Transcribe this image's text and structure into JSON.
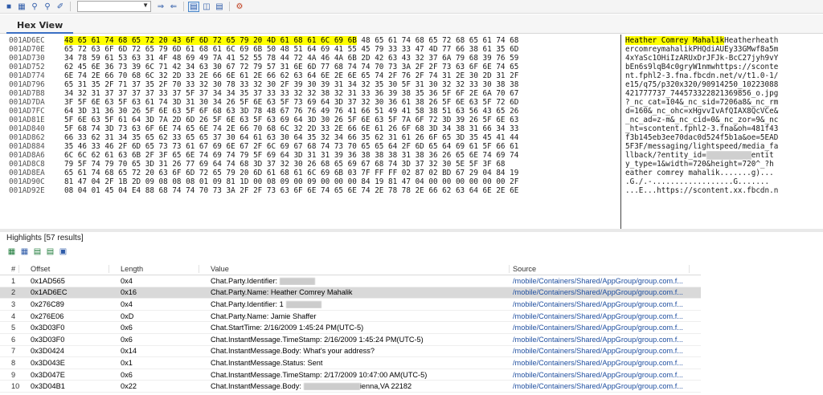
{
  "toolbar": {
    "icons": [
      "save-icon",
      "save-as-icon",
      "find-icon",
      "find-next-icon",
      "paperclip-icon",
      "bookmark-icon",
      "goto-icon",
      "goto-back-icon",
      "view-hex-icon",
      "view-split-icon",
      "view-text-icon",
      "tools-icon"
    ],
    "select_value": ""
  },
  "tab": {
    "label": "Hex View"
  },
  "hex": {
    "offsets": [
      "001AD6EC",
      "001AD70E",
      "001AD730",
      "001AD752",
      "001AD774",
      "001AD796",
      "001AD7B8",
      "001AD7DA",
      "001AD7FC",
      "001AD81E",
      "001AD840",
      "001AD862",
      "001AD884",
      "001AD8A6",
      "001AD8C8",
      "001AD8EA",
      "001AD90C",
      "001AD92E"
    ],
    "highlight_bytes": "48 65 61 74 68 65 72 20 43 6F 6D 72 65 79 20 4D 61 68 61 6C 69 6B",
    "first_row_rest": " 48 65 61 74 68 65 72 68 65 61 74 68",
    "rows": [
      "65 72 63 6F 6D 72 65 79 6D 61 68 61 6C 69 6B 50 48 51 64 69 41 55 45 79 33 33 47 4D 77 66 38 61 35 6D",
      "34 78 59 61 53 63 31 4F 48 69 49 7A 41 52 55 78 44 72 4A 46 4A 6B 2D 42 63 43 32 37 6A 79 68 39 76 59",
      "62 45 6E 36 73 39 6C 71 42 34 63 30 67 72 79 57 31 6E 6D 77 68 74 74 70 73 3A 2F 2F 73 63 6F 6E 74 65",
      "6E 74 2E 66 70 68 6C 32 2D 33 2E 66 6E 61 2E 66 62 63 64 6E 2E 6E 65 74 2F 76 2F 74 31 2E 30 2D 31 2F",
      "65 31 35 2F 71 37 35 2F 70 33 32 30 78 33 32 30 2F 39 30 39 31 34 32 35 30 5F 31 30 32 32 33 30 38 38",
      "34 32 31 37 37 37 37 33 37 5F 37 34 34 35 37 33 33 32 32 38 32 31 33 36 39 38 35 36 5F 6F 2E 6A 70 67",
      "3F 5F 6E 63 5F 63 61 74 3D 31 30 34 26 5F 6E 63 5F 73 69 64 3D 37 32 30 36 61 38 26 5F 6E 63 5F 72 6D",
      "64 3D 31 36 30 26 5F 6E 63 5F 6F 68 63 3D 78 48 67 76 76 49 76 41 66 51 49 41 58 38 51 63 56 43 65 26",
      "5F 6E 63 5F 61 64 3D 7A 2D 6D 26 5F 6E 63 5F 63 69 64 3D 30 26 5F 6E 63 5F 7A 6F 72 3D 39 26 5F 6E 63",
      "5F 68 74 3D 73 63 6F 6E 74 65 6E 74 2E 66 70 68 6C 32 2D 33 2E 66 6E 61 26 6F 68 3D 34 38 31 66 34 33",
      "66 33 62 31 34 35 65 62 33 65 65 37 30 64 61 63 30 64 35 32 34 66 35 62 31 61 26 6F 65 3D 35 45 41 44",
      "35 46 33 46 2F 6D 65 73 73 61 67 69 6E 67 2F 6C 69 67 68 74 73 70 65 65 64 2F 6D 65 64 69 61 5F 66 61",
      "6C 6C 62 61 63 6B 2F 3F 65 6E 74 69 74 79 5F 69 64 3D 31 31 39 36 38 38 38 31 38 36 26 65 6E 74 69 74",
      "79 5F 74 79 70 65 3D 31 26 77 69 64 74 68 3D 37 32 30 26 68 65 69 67 68 74 3D 37 32 30 5E 5F 3F 68",
      "65 61 74 68 65 72 20 63 6F 6D 72 65 79 20 6D 61 68 61 6C 69 6B 03 7F FF FF 02 87 02 BD 67 29 04 84 19",
      "81 47 04 2F 1B 2D 09 08 08 08 01 09 81 1D 00 08 09 00 09 00 00 00 84 19 81 47 04 00 00 00 00 00 00 2F",
      "08 04 01 45 04 E4 88 68 74 74 70 73 3A 2F 2F 73 63 6F 6E 74 65 6E 74 2E 78 78 2E 66 62 63 64 6E 2E 6E"
    ],
    "ascii_highlight": "Heather Comrey Mahalik",
    "ascii_first_rest": "Heatherheath",
    "ascii_rows": [
      "ercomreymahalikPHQdiAUEy33GMwf8a5m",
      "4xYaSc1OHiIzARUxDrJFJk-BcC27jyh9vY",
      "bEn6s9lqB4c0gryW1nmwhttps://sconte",
      "nt.fphl2-3.fna.fbcdn.net/v/t1.0-1/",
      "e15/q75/p320x320/90914250_10223088",
      "421777737_744573322821369856_o.jpg",
      "?_nc_cat=104&_nc_sid=7206a8&_nc_rm",
      "d=160&_nc_ohc=xHgvvIvAfQIAX8QcVCe&",
      "_nc_ad=z-m&_nc_cid=0&_nc_zor=9&_nc",
      "_ht=scontent.fphl2-3.fna&oh=481f43",
      "f3b145eb3ee70dac0d524f5b1a&oe=5EAD",
      "5F3F/messaging/lightspeed/media_fa",
      "llback/?entity_id=",
      "y_type=1&width=720&height=720^_?h",
      "eather comrey mahalik.......g)...",
      ".G./.-..................G.......",
      "...E...https://scontent.xx.fbcdn.n"
    ],
    "ascii_row12_suffix": "entit"
  },
  "highlights": {
    "title": "Highlights [57 results]",
    "toolbar_icons": [
      "excel-export-icon",
      "grid-icon",
      "export-icon",
      "filter-icon",
      "copy-icon"
    ],
    "columns": {
      "num": "#",
      "offset": "Offset",
      "length": "Length",
      "value": "Value",
      "source": "Source"
    },
    "rows": [
      {
        "num": "1",
        "offset": "0x1AD565",
        "length": "0x4",
        "value": "Chat.Party.Identifier:",
        "redacted": true,
        "source": "/mobile/Containers/Shared/AppGroup/group.com.f..."
      },
      {
        "num": "2",
        "offset": "0x1AD6EC",
        "length": "0x16",
        "value": "Chat.Party.Name: Heather Comrey Mahalik",
        "redacted": false,
        "source": "/mobile/Containers/Shared/AppGroup/group.com.f..."
      },
      {
        "num": "3",
        "offset": "0x276C89",
        "length": "0x4",
        "value": "Chat.Party.Identifier: 1",
        "redacted": true,
        "source": "/mobile/Containers/Shared/AppGroup/group.com.f..."
      },
      {
        "num": "4",
        "offset": "0x276E06",
        "length": "0xD",
        "value": "Chat.Party.Name: Jamie Shaffer",
        "redacted": false,
        "source": "/mobile/Containers/Shared/AppGroup/group.com.f..."
      },
      {
        "num": "5",
        "offset": "0x3D03F0",
        "length": "0x6",
        "value": "Chat.StartTime: 2/16/2009 1:45:24 PM(UTC-5)",
        "redacted": false,
        "source": "/mobile/Containers/Shared/AppGroup/group.com.f..."
      },
      {
        "num": "6",
        "offset": "0x3D03F0",
        "length": "0x6",
        "value": "Chat.InstantMessage.TimeStamp: 2/16/2009 1:45:24 PM(UTC-5)",
        "redacted": false,
        "source": "/mobile/Containers/Shared/AppGroup/group.com.f..."
      },
      {
        "num": "7",
        "offset": "0x3D0424",
        "length": "0x14",
        "value": "Chat.InstantMessage.Body: What's your address?",
        "redacted": false,
        "source": "/mobile/Containers/Shared/AppGroup/group.com.f..."
      },
      {
        "num": "8",
        "offset": "0x3D043E",
        "length": "0x1",
        "value": "Chat.InstantMessage.Status: Sent",
        "redacted": false,
        "source": "/mobile/Containers/Shared/AppGroup/group.com.f..."
      },
      {
        "num": "9",
        "offset": "0x3D047E",
        "length": "0x6",
        "value": "Chat.InstantMessage.TimeStamp: 2/17/2009 10:47:00 AM(UTC-5)",
        "redacted": false,
        "source": "/mobile/Containers/Shared/AppGroup/group.com.f..."
      },
      {
        "num": "10",
        "offset": "0x3D04B1",
        "length": "0x22",
        "value": "Chat.InstantMessage.Body:",
        "value_suffix": "ienna,VA 22182",
        "redacted": true,
        "source": "/mobile/Containers/Shared/AppGroup/group.com.f..."
      }
    ]
  }
}
